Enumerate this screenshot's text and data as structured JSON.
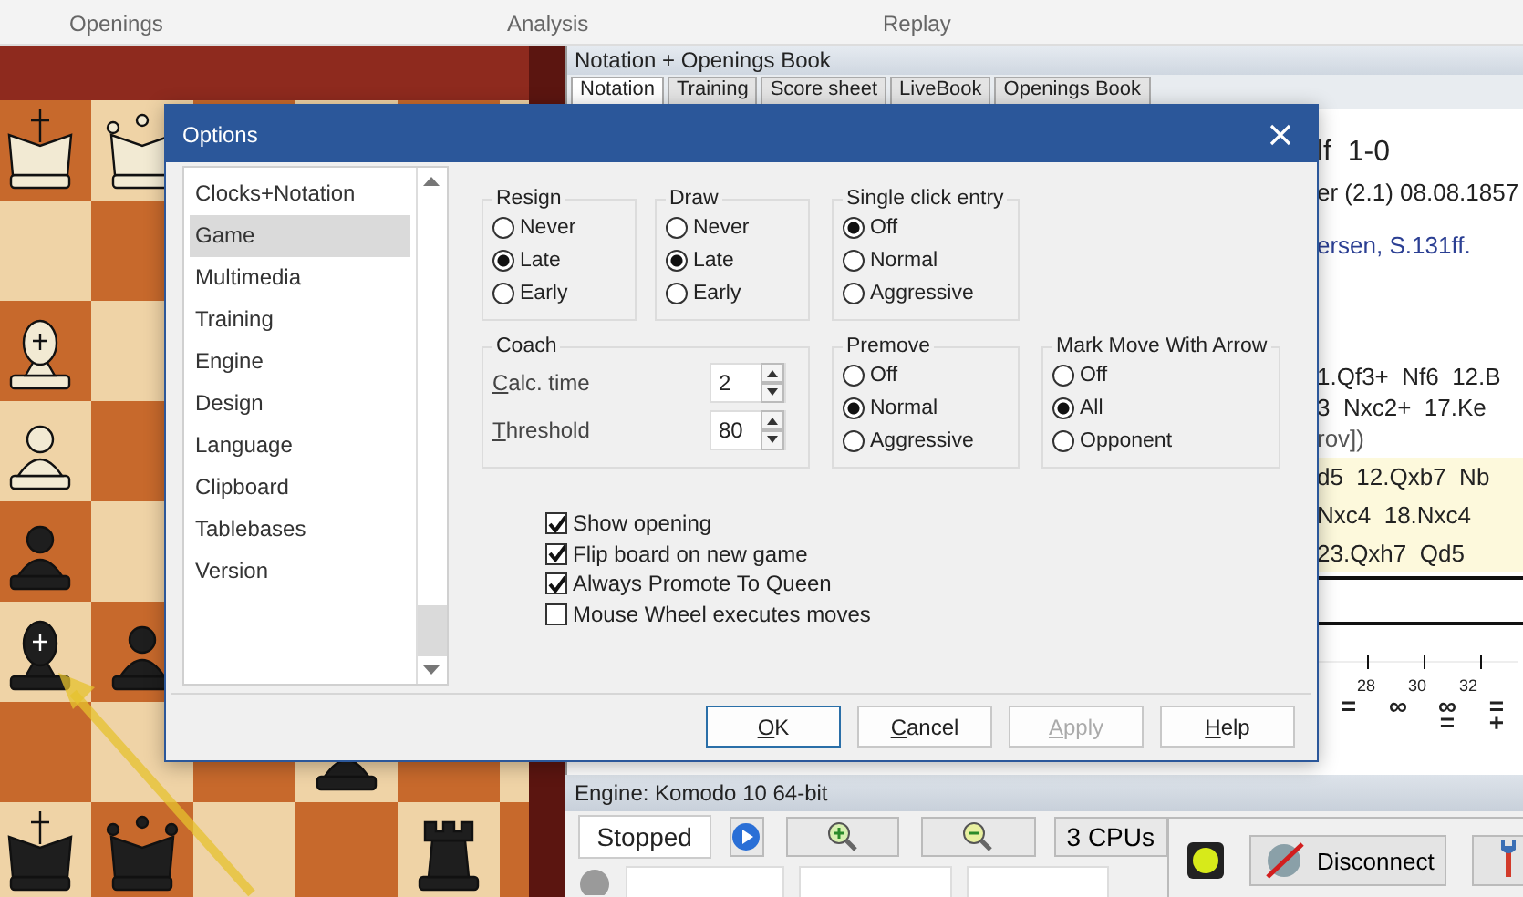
{
  "ribbon": {
    "groups": [
      "Openings",
      "Analysis",
      "Replay"
    ]
  },
  "notation": {
    "title": "Notation + Openings Book",
    "tabs": [
      {
        "label": "Notation",
        "selected": true
      },
      {
        "label": "Training",
        "selected": false
      },
      {
        "label": "Score sheet",
        "selected": false
      },
      {
        "label": "LiveBook",
        "selected": false
      },
      {
        "label": "Openings Book",
        "selected": false
      }
    ],
    "blocks": [
      {
        "kind": "header",
        "lines": [
          "lf  1-0",
          "er (2.1) 08.08.1857"
        ]
      },
      {
        "kind": "comment",
        "lines": [
          "ersen, S.131ff."
        ]
      },
      {
        "kind": "moves",
        "lines": [
          "1.Qf3+  Nf6  12.B",
          "3  Nxc2+  17.Ke",
          "rov])"
        ]
      },
      {
        "kind": "variation",
        "lines": [
          "d5  12.Qxb7  Nb",
          "Nxc4  18.Nxc4",
          "23.Qxh7  Qd5"
        ]
      }
    ],
    "graph_labels": [
      "28",
      "30",
      "32"
    ],
    "symbols": [
      "=",
      "∞",
      "∞\n=",
      "=\n+"
    ]
  },
  "engine": {
    "title": "Engine: Komodo 10 64-bit",
    "status": "Stopped",
    "cpus": "3 CPUs",
    "connect": "Disconnect"
  },
  "dialog": {
    "title": "Options",
    "categories": [
      {
        "label": "Clocks+Notation",
        "selected": false
      },
      {
        "label": "Game",
        "selected": true
      },
      {
        "label": "Multimedia",
        "selected": false
      },
      {
        "label": "Training",
        "selected": false
      },
      {
        "label": "Engine",
        "selected": false
      },
      {
        "label": "Design",
        "selected": false
      },
      {
        "label": "Language",
        "selected": false
      },
      {
        "label": "Clipboard",
        "selected": false
      },
      {
        "label": "Tablebases",
        "selected": false
      },
      {
        "label": "Version",
        "selected": false
      }
    ],
    "groups": [
      {
        "title": "Resign",
        "options": [
          {
            "label": "Never",
            "selected": false
          },
          {
            "label": "Late",
            "selected": true
          },
          {
            "label": "Early",
            "selected": false
          }
        ]
      },
      {
        "title": "Draw",
        "options": [
          {
            "label": "Never",
            "selected": false
          },
          {
            "label": "Late",
            "selected": true
          },
          {
            "label": "Early",
            "selected": false
          }
        ]
      },
      {
        "title": "Single click entry",
        "options": [
          {
            "label": "Off",
            "selected": true
          },
          {
            "label": "Normal",
            "selected": false
          },
          {
            "label": "Aggressive",
            "selected": false
          }
        ]
      },
      {
        "title": "Premove",
        "options": [
          {
            "label": "Off",
            "selected": false
          },
          {
            "label": "Normal",
            "selected": true
          },
          {
            "label": "Aggressive",
            "selected": false
          }
        ]
      },
      {
        "title": "Mark Move With Arrow",
        "options": [
          {
            "label": "Off",
            "selected": false
          },
          {
            "label": "All",
            "selected": true
          },
          {
            "label": "Opponent",
            "selected": false
          }
        ]
      }
    ],
    "coach": {
      "title": "Coach",
      "fields": [
        {
          "label": "Calc. time",
          "value": "2"
        },
        {
          "label": "Threshold",
          "value": "80"
        }
      ]
    },
    "checkboxes": [
      {
        "label": "Show opening",
        "checked": true
      },
      {
        "label": "Flip board on new game",
        "checked": true
      },
      {
        "label": "Always Promote To Queen",
        "checked": true
      },
      {
        "label": "Mouse Wheel executes moves",
        "checked": false
      }
    ],
    "buttons": [
      {
        "label": "OK",
        "default": true,
        "disabled": false
      },
      {
        "label": "Cancel",
        "default": false,
        "disabled": false
      },
      {
        "label": "Apply",
        "default": false,
        "disabled": true
      },
      {
        "label": "Help",
        "default": false,
        "disabled": false
      }
    ]
  }
}
